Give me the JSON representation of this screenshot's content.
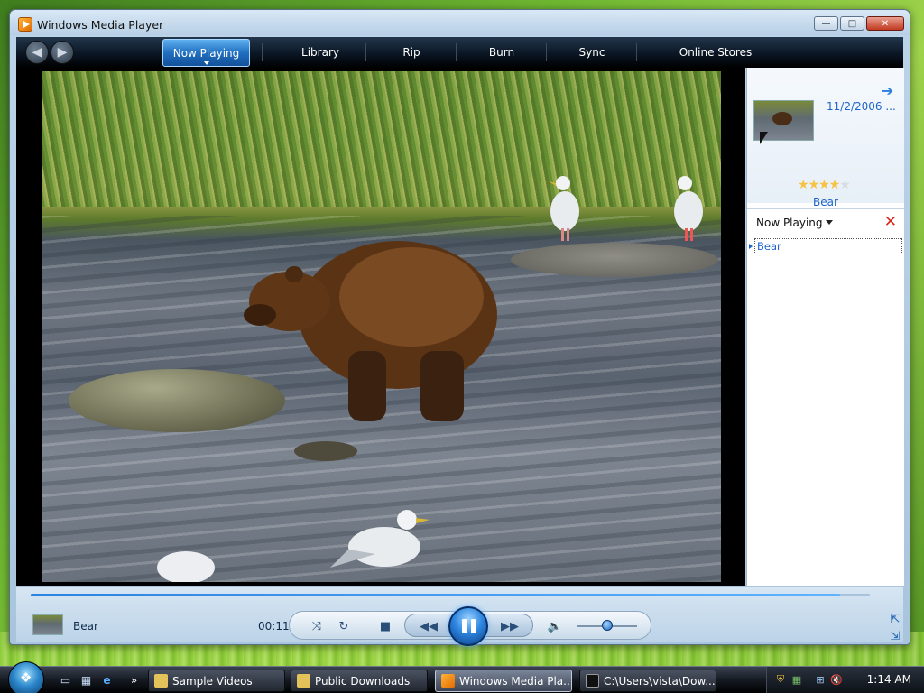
{
  "window": {
    "title": "Windows Media Player",
    "controls": {
      "minimize": "—",
      "maximize": "□",
      "close": "✕"
    }
  },
  "nav": {
    "back_icon": "back-arrow-icon",
    "forward_icon": "forward-arrow-icon",
    "tabs": [
      {
        "label": "Now Playing",
        "active": true
      },
      {
        "label": "Library",
        "active": false
      },
      {
        "label": "Rip",
        "active": false
      },
      {
        "label": "Burn",
        "active": false
      },
      {
        "label": "Sync",
        "active": false
      },
      {
        "label": "Online Stores",
        "active": false
      }
    ]
  },
  "info_pane": {
    "date": "11/2/2006 ...",
    "title": "Bear",
    "rating": 4,
    "rating_max": 5
  },
  "playlist": {
    "header": "Now Playing",
    "items": [
      "Bear"
    ]
  },
  "player": {
    "now_playing_title": "Bear",
    "elapsed": "00:11",
    "progress": 0.965,
    "volume": 0.5
  },
  "taskbar": {
    "tasks": [
      {
        "label": "Sample Videos",
        "active": false
      },
      {
        "label": "Public Downloads",
        "active": false
      },
      {
        "label": "Windows Media Pla...",
        "active": true
      },
      {
        "label": "C:\\Users\\vista\\Dow...",
        "active": false
      }
    ],
    "clock": "1:14 AM"
  },
  "colors": {
    "accent": "#1e64c8",
    "tab_active": "#2d86e0",
    "clear_x": "#d62b1f",
    "star_on": "#f5c241"
  }
}
